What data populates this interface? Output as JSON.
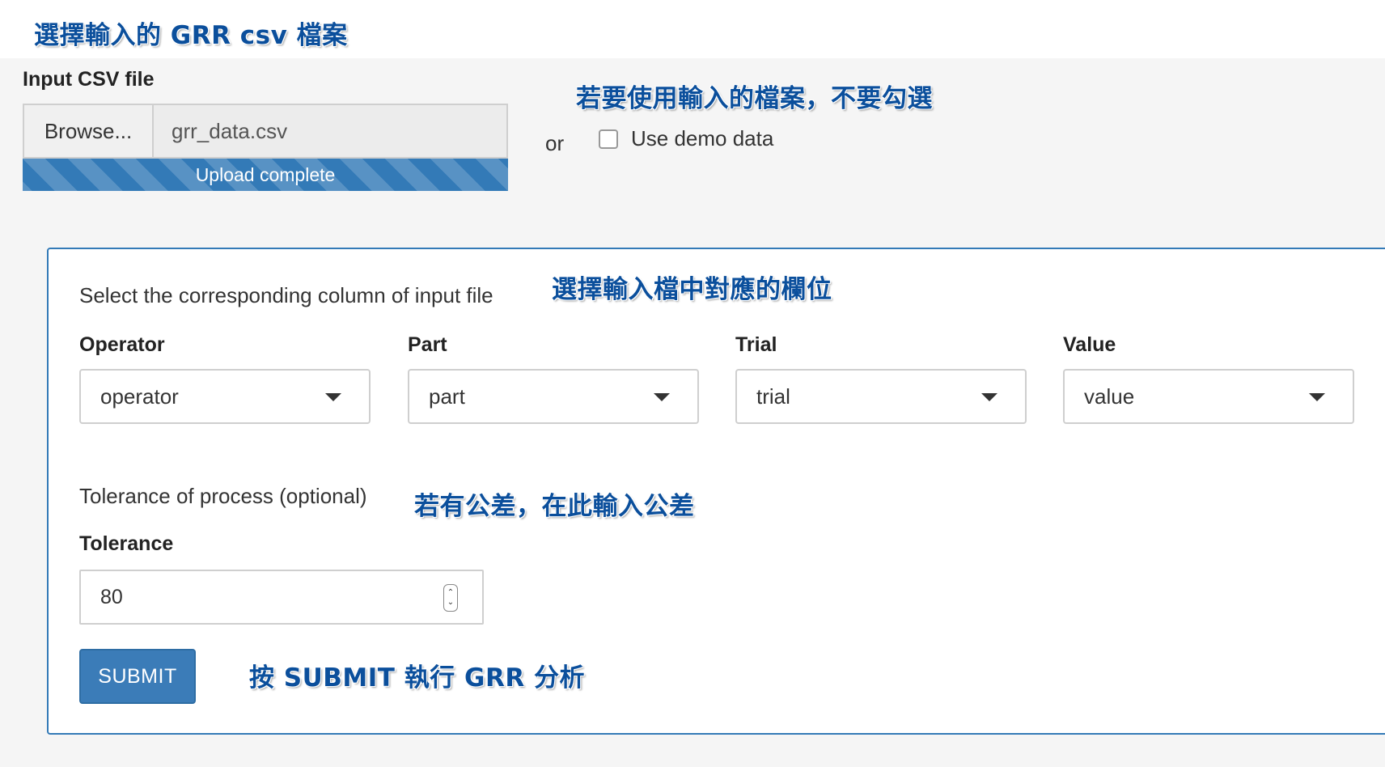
{
  "annotations": {
    "file_select": "選擇輸入的 GRR csv 檔案",
    "no_demo": "若要使用輸入的檔案，不要勾選",
    "select_columns": "選擇輸入檔中對應的欄位",
    "tolerance_hint": "若有公差，在此輸入公差",
    "submit_hint": "按 SUBMIT 執行 GRR 分析"
  },
  "file_input": {
    "label": "Input CSV file",
    "browse_label": "Browse...",
    "file_name": "grr_data.csv",
    "progress_text": "Upload complete",
    "progress_fraction": 1.0
  },
  "demo": {
    "or_text": "or",
    "checkbox_label": "Use demo data",
    "checked": false
  },
  "panel": {
    "instruction": "Select the corresponding column of input file",
    "selects": [
      {
        "label": "Operator",
        "value": "operator"
      },
      {
        "label": "Part",
        "value": "part"
      },
      {
        "label": "Trial",
        "value": "trial"
      },
      {
        "label": "Value",
        "value": "value"
      }
    ],
    "tolerance_section": "Tolerance of process (optional)",
    "tolerance_label": "Tolerance",
    "tolerance_value": "80",
    "submit_label": "SUBMIT"
  },
  "colors": {
    "accent": "#337ab7",
    "annotation": "#0b4f9c",
    "background": "#f5f5f5"
  }
}
